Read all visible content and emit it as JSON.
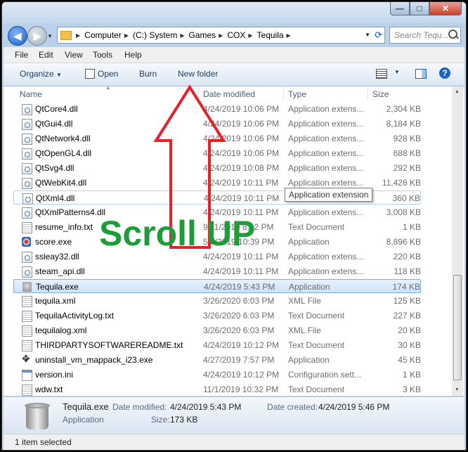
{
  "window": {
    "close": "✕",
    "maximize": "□",
    "minimize": "—"
  },
  "breadcrumb": [
    "Computer",
    "(C:) System",
    "Games",
    "COX",
    "Tequila"
  ],
  "search": {
    "placeholder": "Search Tequ..."
  },
  "menu": [
    "File",
    "Edit",
    "View",
    "Tools",
    "Help"
  ],
  "toolbar": {
    "organize": "Organize",
    "open": "Open",
    "burn": "Burn",
    "new_folder": "New folder",
    "help": "?"
  },
  "columns": {
    "name": "Name",
    "date": "Date modified",
    "type": "Type",
    "size": "Size"
  },
  "files": [
    {
      "name": "QtCore4.dll",
      "date": "4/24/2019 10:06 PM",
      "type": "Application extens...",
      "size": "2,304 KB",
      "icon": "dll-icon"
    },
    {
      "name": "QtGui4.dll",
      "date": "4/24/2019 10:06 PM",
      "type": "Application extens...",
      "size": "8,184 KB",
      "icon": "dll-icon"
    },
    {
      "name": "QtNetwork4.dll",
      "date": "4/24/2019 10:06 PM",
      "type": "Application extens...",
      "size": "928 KB",
      "icon": "dll-icon"
    },
    {
      "name": "QtOpenGL4.dll",
      "date": "4/24/2019 10:06 PM",
      "type": "Application extens...",
      "size": "688 KB",
      "icon": "dll-icon"
    },
    {
      "name": "QtSvg4.dll",
      "date": "4/24/2019 10:08 PM",
      "type": "Application extens...",
      "size": "292 KB",
      "icon": "dll-icon"
    },
    {
      "name": "QtWebKit4.dll",
      "date": "4/24/2019 10:11 PM",
      "type": "Application extens...",
      "size": "11,428 KB",
      "icon": "dll-icon"
    },
    {
      "name": "QtXml4.dll",
      "date": "4/24/2019 10:11 PM",
      "type": "",
      "size": "360 KB",
      "icon": "dll-icon"
    },
    {
      "name": "QtXmlPatterns4.dll",
      "date": "4/24/2019 10:11 PM",
      "type": "Application extens...",
      "size": "3,008 KB",
      "icon": "dll-icon"
    },
    {
      "name": "resume_info.txt",
      "date": "9/11/2019 8:12 PM",
      "type": "Text Document",
      "size": "1 KB",
      "icon": "text-file-icon"
    },
    {
      "name": "score.exe",
      "date": "5/6/2019 10:39 PM",
      "type": "Application",
      "size": "8,896 KB",
      "icon": "score-exe-icon"
    },
    {
      "name": "ssleay32.dll",
      "date": "4/24/2019 10:11 PM",
      "type": "Application extens...",
      "size": "220 KB",
      "icon": "dll-icon"
    },
    {
      "name": "steam_api.dll",
      "date": "4/24/2019 10:11 PM",
      "type": "Application extens...",
      "size": "118 KB",
      "icon": "dll-icon"
    },
    {
      "name": "Tequila.exe",
      "date": "4/24/2019 5:43 PM",
      "type": "Application",
      "size": "174 KB",
      "icon": "tequila-exe-icon"
    },
    {
      "name": "tequila.xml",
      "date": "3/26/2020 6:03 PM",
      "type": "XML File",
      "size": "125 KB",
      "icon": "text-file-icon"
    },
    {
      "name": "TequilaActivityLog.txt",
      "date": "3/26/2020 6:03 PM",
      "type": "Text Document",
      "size": "227 KB",
      "icon": "text-file-icon"
    },
    {
      "name": "tequilalog.xml",
      "date": "3/26/2020 6:03 PM",
      "type": "XML File",
      "size": "20 KB",
      "icon": "text-file-icon"
    },
    {
      "name": "THIRDPARTYSOFTWAREREADME.txt",
      "date": "4/24/2019 10:12 PM",
      "type": "Text Document",
      "size": "30 KB",
      "icon": "text-file-icon"
    },
    {
      "name": "uninstall_vm_mappack_i23.exe",
      "date": "4/27/2019 7:57 PM",
      "type": "Application",
      "size": "45 KB",
      "icon": "uninstall-exe-icon"
    },
    {
      "name": "version.ini",
      "date": "4/24/2019 10:12 PM",
      "type": "Configuration sett...",
      "size": "1 KB",
      "icon": "ini-file-icon"
    },
    {
      "name": "wdw.txt",
      "date": "11/1/2019 10:32 PM",
      "type": "Text Document",
      "size": "3 KB",
      "icon": "text-file-icon"
    }
  ],
  "tooltip": "Application extension",
  "details": {
    "name": "Tequila.exe",
    "kind": "Application",
    "modified_label": "Date modified:",
    "modified_value": "4/24/2019 5:43 PM",
    "created_label": "Date created:",
    "created_value": "4/24/2019 5:46 PM",
    "size_label": "Size:",
    "size_value": "173 KB"
  },
  "status": "1 item selected",
  "annotation": {
    "text": "Scroll UP",
    "arrow_color": "#e8202a",
    "text_color": "#1f9c3a"
  }
}
